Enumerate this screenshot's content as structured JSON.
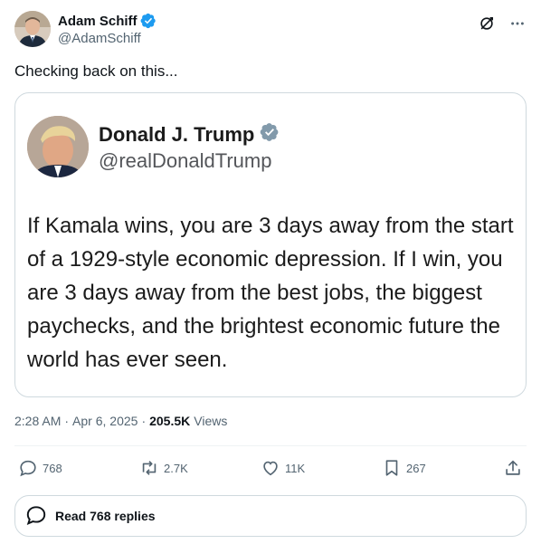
{
  "author": {
    "name": "Adam Schiff",
    "handle": "@AdamSchiff"
  },
  "tweet": {
    "text": "Checking back on this..."
  },
  "embedded_post": {
    "name": "Donald J. Trump",
    "handle": "@realDonaldTrump",
    "body": "If Kamala wins, you are 3 days away from the start of a 1929-style economic depression. If I win, you are 3 days away from the best jobs, the biggest paychecks, and the brightest economic future the world has ever seen."
  },
  "meta": {
    "time": "2:28 AM",
    "separator1": "·",
    "date": "Apr 6, 2025",
    "separator2": "·",
    "views_count": "205.5K",
    "views_label": "Views"
  },
  "actions": {
    "replies": "768",
    "reposts": "2.7K",
    "likes": "11K",
    "bookmarks": "267"
  },
  "read_replies": {
    "label": "Read 768 replies"
  },
  "colors": {
    "verified": "#1d9bf0",
    "verified_gray": "#829aab",
    "text_secondary": "#536471",
    "border": "#cfd9de"
  },
  "icons": [
    "grok-icon",
    "more-icon",
    "reply-icon",
    "repost-icon",
    "like-icon",
    "bookmark-icon",
    "share-icon",
    "replies-bubble-icon"
  ]
}
